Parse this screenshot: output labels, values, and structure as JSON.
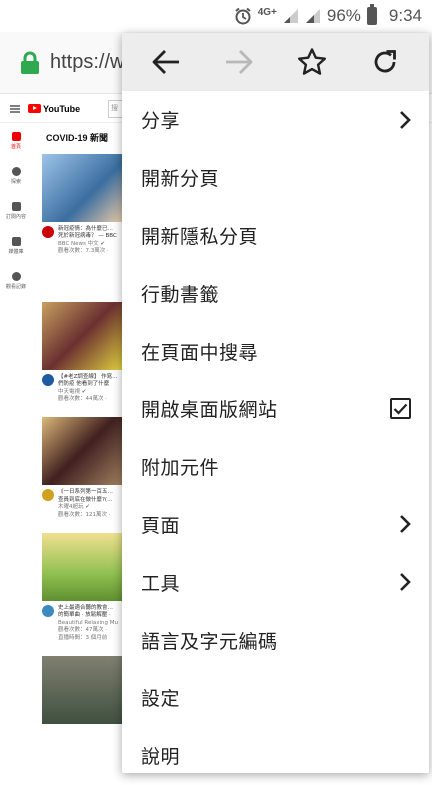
{
  "status": {
    "time": "9:34",
    "battery": "96%",
    "network": "4G+"
  },
  "urlbar": {
    "url": "https://w"
  },
  "youtube": {
    "logo": "YouTube",
    "search_placeholder": "搜",
    "sidebar": [
      "首頁",
      "探索",
      "訂閱內容",
      "媒體庫",
      "觀看記錄"
    ],
    "section": "COVID-19 新聞",
    "videos": [
      {
        "title": "新冠疫情：為什麼已…",
        "line2": "死於新冠病毒？ — BBC",
        "channel": "BBC News 中文 ✔",
        "views": "觀看次數：7.3萬次 ·"
      },
      {
        "title": "【#老Z調查線】 作寫…",
        "line2": "們防疫 他看到了什麼",
        "channel": "中天電視 ✔",
        "views": "觀看次數：44萬次 ·"
      },
      {
        "title": "《一日系列第一百五…",
        "line2": "查員到底在做什麼?(…",
        "channel": "木曜4超玩 ✔",
        "views": "觀看次數：121萬次 ·"
      },
      {
        "title": "史上最適合聽的教會…",
        "line2": "的簡單曲 · 放鬆解壓 ·",
        "channel": "Beautiful Relaxing Mu",
        "views": "觀看次數：47萬次 ·",
        "extra": "直播時間：3 個月前"
      },
      {
        "title": "",
        "line2": "",
        "channel": "",
        "views": ""
      }
    ]
  },
  "menu": {
    "toolbar": {
      "back": "back",
      "forward": "forward",
      "bookmark": "star",
      "reload": "reload"
    },
    "items": [
      {
        "label": "分享",
        "trailing": "chevron"
      },
      {
        "label": "開新分頁",
        "trailing": ""
      },
      {
        "label": "開新隱私分頁",
        "trailing": ""
      },
      {
        "label": "行動書籤",
        "trailing": ""
      },
      {
        "label": "在頁面中搜尋",
        "trailing": ""
      },
      {
        "label": "開啟桌面版網站",
        "trailing": "checkbox-checked"
      },
      {
        "label": "附加元件",
        "trailing": ""
      },
      {
        "label": "頁面",
        "trailing": "chevron"
      },
      {
        "label": "工具",
        "trailing": "chevron"
      },
      {
        "label": "語言及字元編碼",
        "trailing": ""
      },
      {
        "label": "設定",
        "trailing": ""
      },
      {
        "label": "說明",
        "trailing": ""
      }
    ]
  },
  "colors": {
    "lock": "#2fa84f",
    "menu_toolbar_bg": "#ededed",
    "yt_red": "#ff0000"
  }
}
